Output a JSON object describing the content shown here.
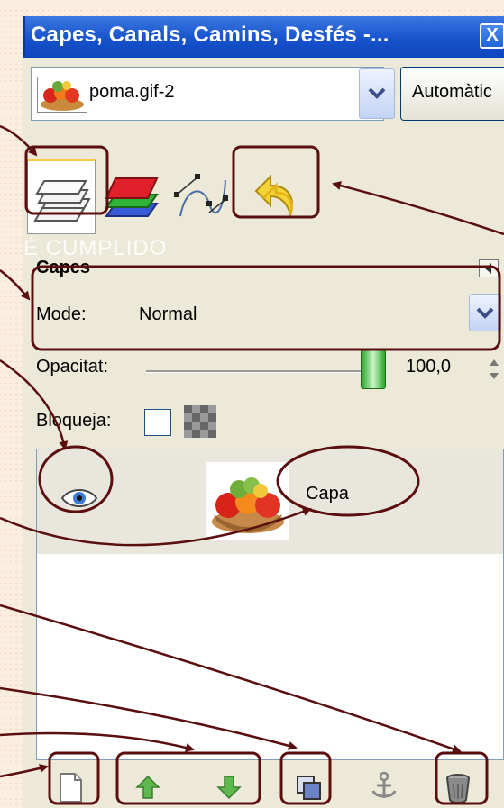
{
  "window": {
    "title": "Capes, Canals, Camins, Desfés -...",
    "close_glyph": "X"
  },
  "image_selector": {
    "value": "poma.gif-2",
    "auto_button_label": "Automàtic"
  },
  "tabs": [
    {
      "icon": "layers-icon",
      "active": true
    },
    {
      "icon": "channels-icon",
      "active": false
    },
    {
      "icon": "paths-icon",
      "active": false
    },
    {
      "icon": "undo-icon",
      "active": false
    }
  ],
  "watermark": "É CUMPLIDO",
  "layers_panel": {
    "title": "Capes",
    "mode_label": "Mode:",
    "mode_value": "Normal",
    "opacity_label": "Opacitat:",
    "opacity_value": "100,0",
    "opacity_fraction": 1.0,
    "lock_label": "Bloqueja:"
  },
  "layers": [
    {
      "name": "Capa",
      "visible": true
    }
  ],
  "bottom_buttons": [
    "new-layer-icon",
    "raise-layer-icon",
    "lower-layer-icon",
    "duplicate-layer-icon",
    "anchor-layer-icon",
    "delete-layer-icon"
  ],
  "colors": {
    "titlebar": "#1753cc",
    "annotation": "#5a0e0e",
    "panel": "#ece9d8"
  }
}
